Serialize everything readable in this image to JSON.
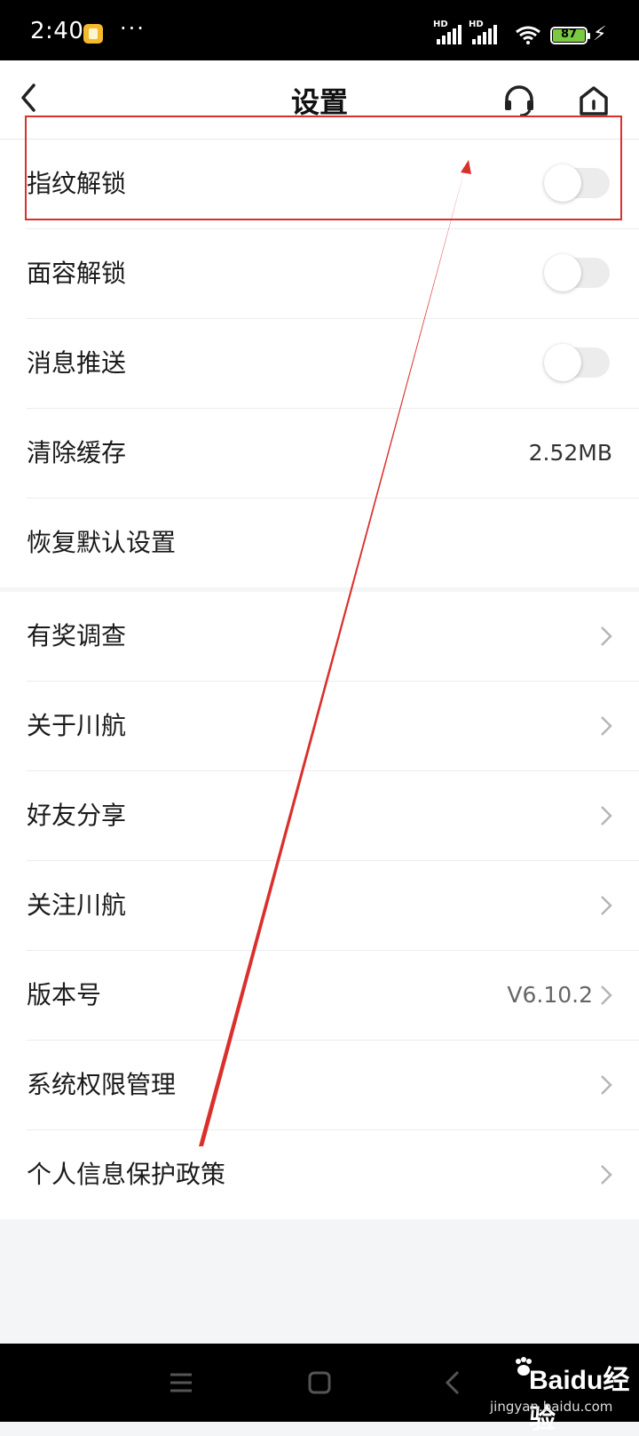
{
  "status_bar": {
    "time": "2:40",
    "more_indicator": "···",
    "signal_labels": [
      "HD",
      "HD"
    ],
    "battery_level": "87",
    "icons": [
      "notification-app-icon",
      "signal-icon",
      "signal-icon",
      "wifi-icon",
      "battery-icon",
      "charging-icon"
    ]
  },
  "header": {
    "title": "设置",
    "icons": [
      "back-icon",
      "headset-icon",
      "home-icon"
    ]
  },
  "toggles_group": [
    {
      "label": "指纹解锁",
      "toggle_on": false
    },
    {
      "label": "面容解锁",
      "toggle_on": false
    },
    {
      "label": "消息推送",
      "toggle_on": false
    }
  ],
  "cache_row": {
    "label": "清除缓存",
    "value": "2.52MB"
  },
  "reset_row": {
    "label": "恢复默认设置"
  },
  "links_group": [
    {
      "label": "有奖调查"
    },
    {
      "label": "关于川航"
    },
    {
      "label": "好友分享"
    },
    {
      "label": "关注川航"
    },
    {
      "label": "版本号",
      "value": "V6.10.2"
    },
    {
      "label": "系统权限管理"
    },
    {
      "label": "个人信息保护政策"
    }
  ],
  "annotation": {
    "highlight_color": "#d9302c"
  },
  "colors": {
    "toggle_off": "#ececec",
    "page_bg": "#f4f5f7",
    "battery_fill": "#7ac943"
  },
  "watermark": {
    "text": "Baidu经验",
    "url": "jingyan.baidu.com"
  }
}
